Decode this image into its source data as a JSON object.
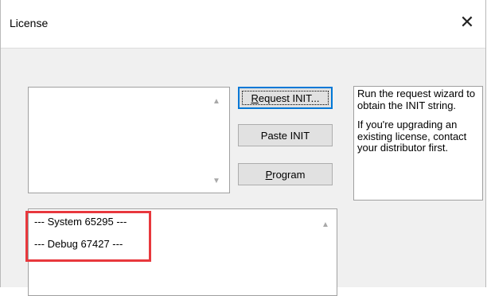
{
  "window": {
    "title": "License",
    "close_symbol": "✕"
  },
  "buttons": {
    "request_init": {
      "prefix": "",
      "mnemonic": "R",
      "rest": "equest INIT..."
    },
    "paste_init": {
      "label": "Paste INIT"
    },
    "program": {
      "prefix": "",
      "mnemonic": "P",
      "rest": "rogram"
    }
  },
  "info": {
    "paragraph1": "Run the request wizard to obtain the INIT string.",
    "paragraph2": "If you're upgrading an existing license, contact your distributor first."
  },
  "license_lines": [
    "--- System 65295 ---",
    "--- Debug 67427 ---"
  ],
  "colors": {
    "highlight": "#e8383d",
    "focus_border": "#0078d7"
  }
}
